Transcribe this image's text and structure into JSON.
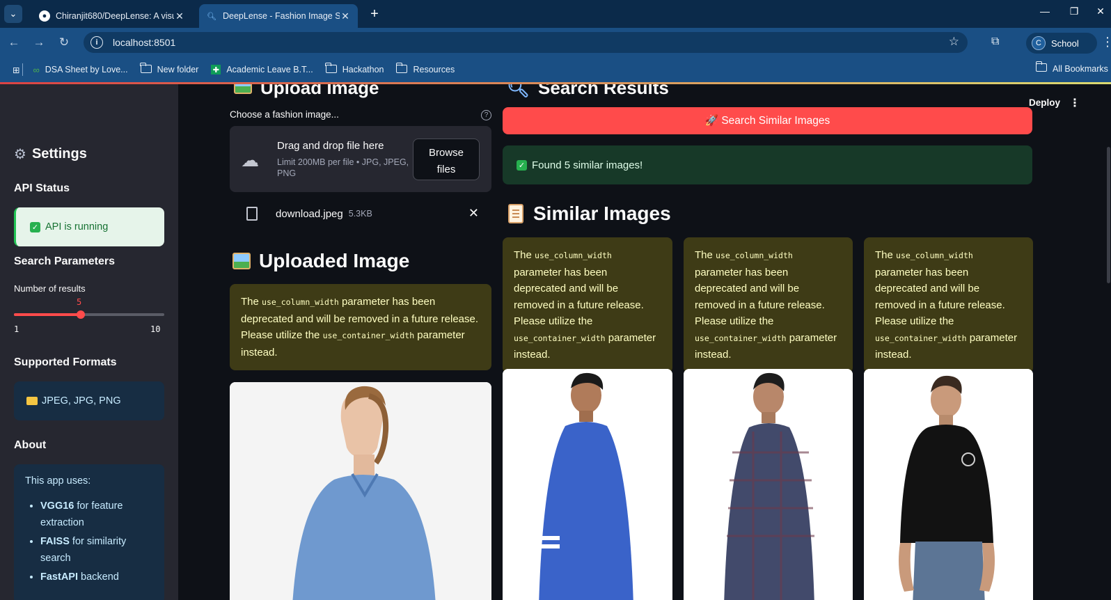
{
  "browser": {
    "tabs": [
      {
        "title": "Chiranjit680/DeepLense: A visu",
        "active": false
      },
      {
        "title": "DeepLense - Fashion Image Sea",
        "active": true
      }
    ],
    "url": "localhost:8501",
    "profile_initial": "C",
    "profile_name": "School",
    "bookmarks": [
      "DSA Sheet by Love...",
      "New folder",
      "Academic Leave B.T...",
      "Hackathon",
      "Resources"
    ],
    "all_bookmarks": "All Bookmarks"
  },
  "sidebar": {
    "settings_title": "Settings",
    "api_status_heading": "API Status",
    "api_status_text": "API is running",
    "search_params_heading": "Search Parameters",
    "slider_label": "Number of results",
    "slider_value": "5",
    "slider_min": "1",
    "slider_max": "10",
    "slider_fraction": 0.4444,
    "formats_heading": "Supported Formats",
    "formats_text": "JPEG, JPG, PNG",
    "about_heading": "About",
    "about_intro": "This app uses:",
    "about_items": [
      {
        "bold": "VGG16",
        "rest": " for feature extraction"
      },
      {
        "bold": "FAISS",
        "rest": " for similarity search"
      },
      {
        "bold": "FastAPI",
        "rest": " backend"
      }
    ]
  },
  "main": {
    "deploy_label": "Deploy",
    "upload_heading": "Upload Image",
    "uploader_label": "Choose a fashion image...",
    "dropzone_title": "Drag and drop file here",
    "dropzone_sub": "Limit 200MB per file • JPG, JPEG, PNG",
    "browse_line1": "Browse",
    "browse_line2": "files",
    "file_name": "download.jpeg",
    "file_size": "5.3KB",
    "uploaded_heading": "Uploaded Image",
    "search_heading": "Search Results",
    "search_button": "🚀 Search Similar Images",
    "found_text": "Found 5 similar images!",
    "similar_heading": "Similar Images",
    "warning": {
      "p1": "The ",
      "code1": "use_column_width",
      "p2": " parameter has been deprecated and will be removed in a future release. Please utilize the ",
      "code2": "use_container_width",
      "p3": " parameter instead."
    }
  },
  "colors": {
    "accent": "#ff4b4b",
    "sidebar_bg": "#262730",
    "main_bg": "#0e1117",
    "warning_bg": "#3e3b16",
    "success_bg": "#173928"
  },
  "icons": [
    "chevron-down-icon",
    "github-icon",
    "close-icon",
    "plus-icon",
    "back-icon",
    "forward-icon",
    "reload-icon",
    "info-icon",
    "star-icon",
    "extensions-icon",
    "apps-icon",
    "folder-icon",
    "gear-icon",
    "check-icon",
    "cloud-upload-icon",
    "file-icon",
    "help-icon"
  ]
}
